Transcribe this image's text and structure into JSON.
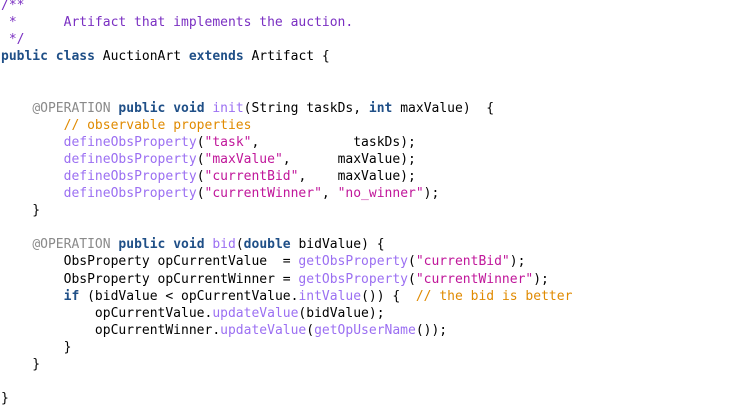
{
  "editor": {
    "lines": [
      [
        {
          "t": "/**",
          "c": "comment"
        }
      ],
      [
        {
          "t": " *      Artifact that implements the auction.",
          "c": "comment"
        }
      ],
      [
        {
          "t": " */",
          "c": "comment"
        }
      ],
      [
        {
          "t": "public",
          "c": "keyword"
        },
        {
          "t": " ",
          "c": "plain"
        },
        {
          "t": "class",
          "c": "keyword"
        },
        {
          "t": " AuctionArt ",
          "c": "plain"
        },
        {
          "t": "extends",
          "c": "keyword"
        },
        {
          "t": " Artifact {",
          "c": "plain"
        }
      ],
      [],
      [],
      [
        {
          "t": "    ",
          "c": "plain"
        },
        {
          "t": "@OPERATION",
          "c": "annotation"
        },
        {
          "t": " ",
          "c": "plain"
        },
        {
          "t": "public",
          "c": "keyword"
        },
        {
          "t": " ",
          "c": "plain"
        },
        {
          "t": "void",
          "c": "keyword"
        },
        {
          "t": " ",
          "c": "plain"
        },
        {
          "t": "init",
          "c": "method"
        },
        {
          "t": "(String taskDs, ",
          "c": "plain"
        },
        {
          "t": "int",
          "c": "keyword"
        },
        {
          "t": " maxValue)  {",
          "c": "plain"
        }
      ],
      [
        {
          "t": "        ",
          "c": "plain"
        },
        {
          "t": "// observable properties",
          "c": "inline-comment"
        }
      ],
      [
        {
          "t": "        ",
          "c": "plain"
        },
        {
          "t": "defineObsProperty",
          "c": "method"
        },
        {
          "t": "(",
          "c": "plain"
        },
        {
          "t": "\"task\"",
          "c": "string"
        },
        {
          "t": ",            taskDs);",
          "c": "plain"
        }
      ],
      [
        {
          "t": "        ",
          "c": "plain"
        },
        {
          "t": "defineObsProperty",
          "c": "method"
        },
        {
          "t": "(",
          "c": "plain"
        },
        {
          "t": "\"maxValue\"",
          "c": "string"
        },
        {
          "t": ",      maxValue);",
          "c": "plain"
        }
      ],
      [
        {
          "t": "        ",
          "c": "plain"
        },
        {
          "t": "defineObsProperty",
          "c": "method"
        },
        {
          "t": "(",
          "c": "plain"
        },
        {
          "t": "\"currentBid\"",
          "c": "string"
        },
        {
          "t": ",    maxValue);",
          "c": "plain"
        }
      ],
      [
        {
          "t": "        ",
          "c": "plain"
        },
        {
          "t": "defineObsProperty",
          "c": "method"
        },
        {
          "t": "(",
          "c": "plain"
        },
        {
          "t": "\"currentWinner\"",
          "c": "string"
        },
        {
          "t": ", ",
          "c": "plain"
        },
        {
          "t": "\"no_winner\"",
          "c": "string"
        },
        {
          "t": ");",
          "c": "plain"
        }
      ],
      [
        {
          "t": "    }",
          "c": "plain"
        }
      ],
      [],
      [
        {
          "t": "    ",
          "c": "plain"
        },
        {
          "t": "@OPERATION",
          "c": "annotation"
        },
        {
          "t": " ",
          "c": "plain"
        },
        {
          "t": "public",
          "c": "keyword"
        },
        {
          "t": " ",
          "c": "plain"
        },
        {
          "t": "void",
          "c": "keyword"
        },
        {
          "t": " ",
          "c": "plain"
        },
        {
          "t": "bid",
          "c": "method"
        },
        {
          "t": "(",
          "c": "plain"
        },
        {
          "t": "double",
          "c": "keyword"
        },
        {
          "t": " bidValue) {",
          "c": "plain"
        }
      ],
      [
        {
          "t": "        ObsProperty opCurrentValue  = ",
          "c": "plain"
        },
        {
          "t": "getObsProperty",
          "c": "method"
        },
        {
          "t": "(",
          "c": "plain"
        },
        {
          "t": "\"currentBid\"",
          "c": "string"
        },
        {
          "t": ");",
          "c": "plain"
        }
      ],
      [
        {
          "t": "        ObsProperty opCurrentWinner = ",
          "c": "plain"
        },
        {
          "t": "getObsProperty",
          "c": "method"
        },
        {
          "t": "(",
          "c": "plain"
        },
        {
          "t": "\"currentWinner\"",
          "c": "string"
        },
        {
          "t": ");",
          "c": "plain"
        }
      ],
      [
        {
          "t": "        ",
          "c": "plain"
        },
        {
          "t": "if",
          "c": "keyword"
        },
        {
          "t": " (bidValue < opCurrentValue.",
          "c": "plain"
        },
        {
          "t": "intValue",
          "c": "method"
        },
        {
          "t": "()) {  ",
          "c": "plain"
        },
        {
          "t": "// the bid is better",
          "c": "inline-comment"
        }
      ],
      [
        {
          "t": "            opCurrentValue.",
          "c": "plain"
        },
        {
          "t": "updateValue",
          "c": "method"
        },
        {
          "t": "(bidValue);",
          "c": "plain"
        }
      ],
      [
        {
          "t": "            opCurrentWinner.",
          "c": "plain"
        },
        {
          "t": "updateValue",
          "c": "method"
        },
        {
          "t": "(",
          "c": "plain"
        },
        {
          "t": "getOpUserName",
          "c": "method"
        },
        {
          "t": "());",
          "c": "plain"
        }
      ],
      [
        {
          "t": "        }",
          "c": "plain"
        }
      ],
      [
        {
          "t": "    }",
          "c": "plain"
        }
      ],
      [],
      [
        {
          "t": "}",
          "c": "plain"
        }
      ]
    ]
  }
}
